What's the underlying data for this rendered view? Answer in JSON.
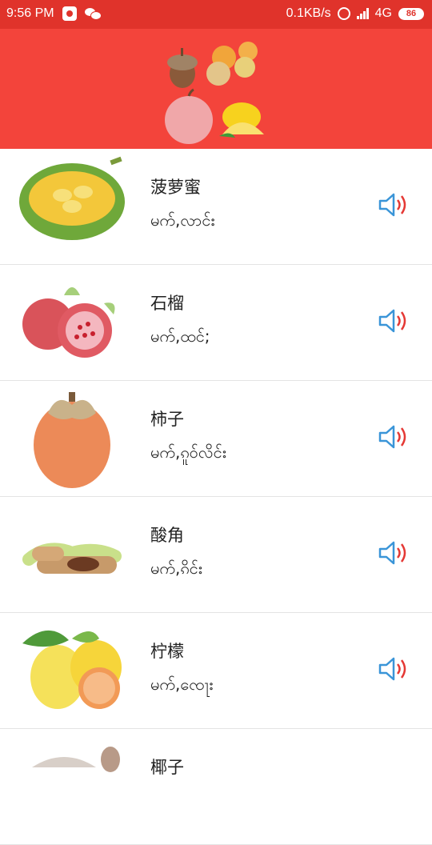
{
  "status_bar": {
    "time": "9:56 PM",
    "speed": "0.1KB/s",
    "network": "4G",
    "battery": "86"
  },
  "banner": {
    "image": "fruits-collage"
  },
  "items": [
    {
      "cn": "菠萝蜜",
      "my": "မက်,လာင်း",
      "icon": "jackfruit-image"
    },
    {
      "cn": "石榴",
      "my": "မက်,ထင်;",
      "icon": "pomegranate-image"
    },
    {
      "cn": "柿子",
      "my": "မက်,ၵူဝ်လိင်း",
      "icon": "persimmon-image"
    },
    {
      "cn": "酸角",
      "my": "မက်,ၵိင်း",
      "icon": "tamarind-image"
    },
    {
      "cn": "柠檬",
      "my": "မက်,ၸေႃး",
      "icon": "lemon-image"
    },
    {
      "cn": "椰子",
      "my": "",
      "icon": "coconut-image"
    }
  ],
  "colors": {
    "header": "#f3443b",
    "status_bar": "#e0332b",
    "speaker_blue": "#3a95d8",
    "speaker_red": "#e53935"
  }
}
